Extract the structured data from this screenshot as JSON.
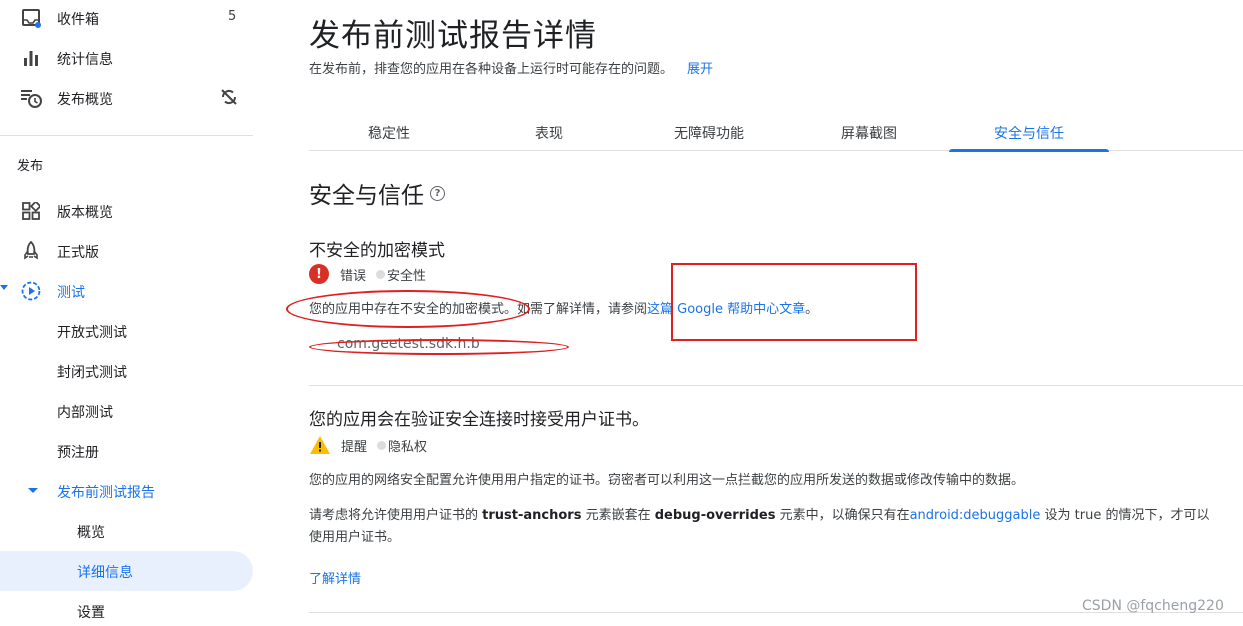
{
  "sidebar": {
    "top_items": [
      {
        "label": "收件箱",
        "count": "5",
        "icon": "inbox-icon"
      },
      {
        "label": "统计信息",
        "icon": "bar-chart-icon"
      },
      {
        "label": "发布概览",
        "icon": "publish-overview-icon",
        "trail_icon": "sync-off-icon"
      }
    ],
    "section_title": "发布",
    "release_items": [
      {
        "label": "版本概览",
        "icon": "dashboard-icon"
      },
      {
        "label": "正式版",
        "icon": "rocket-icon"
      },
      {
        "label": "测试",
        "icon": "play-circle-icon"
      }
    ],
    "test_items": [
      "开放式测试",
      "封闭式测试",
      "内部测试",
      "预注册"
    ],
    "report_item": "发布前测试报告",
    "report_subitems": [
      "概览",
      "详细信息",
      "设置"
    ]
  },
  "main": {
    "title": "发布前测试报告详情",
    "subtitle": "在发布前，排查您的应用在各种设备上运行时可能存在的问题。",
    "expand_label": "展开",
    "tabs": [
      "稳定性",
      "表现",
      "无障碍功能",
      "屏幕截图",
      "安全与信任"
    ],
    "active_tab": "安全与信任",
    "section_title": "安全与信任",
    "issues": [
      {
        "title": "不安全的加密模式",
        "severity": "错误",
        "category": "安全性",
        "text_before": "您的应用中存在不安全的加密模式。如需了解详情，请参阅",
        "link": "这篇 Google 帮助中心文章",
        "text_after": "。",
        "class_name": "com.geetest.sdk.h.b"
      },
      {
        "title": "您的应用会在验证安全连接时接受用户证书。",
        "severity": "提醒",
        "category": "隐私权",
        "paragraph1": "您的应用的网络安全配置允许使用用户指定的证书。窃密者可以利用这一点拦截您的应用所发送的数据或修改传输中的数据。",
        "p2_a": "请考虑将允许使用用户证书的 ",
        "p2_b": "trust-anchors",
        "p2_c": " 元素嵌套在 ",
        "p2_d": "debug-overrides",
        "p2_e": " 元素中，以确保只有在",
        "p2_link": "android:debuggable",
        "p2_f": " 设为 true 的情况下，才可以使用用户证书。",
        "learn_more": "了解详情"
      }
    ]
  },
  "watermark": "CSDN @fqcheng220",
  "colors": {
    "accent": "#1a73e8",
    "error": "#d93025",
    "warning": "#fbbc04",
    "annotation": "#e02020"
  }
}
